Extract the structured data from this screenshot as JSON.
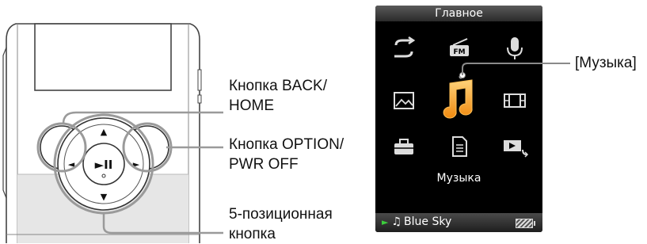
{
  "labels": {
    "back_home": [
      "Кнопка BACK/",
      "HOME"
    ],
    "option_pwr": [
      "Кнопка OPTION/",
      "PWR OFF"
    ],
    "five_way": [
      "5-позиционная",
      "кнопка"
    ],
    "music_callout": "[Музыка]"
  },
  "device": {
    "center_button": "►II",
    "arrows": {
      "up": "▲",
      "down": "▼",
      "left": "◄",
      "right": "►"
    }
  },
  "screen": {
    "title": "Главное",
    "caption": "Музыка",
    "icons": [
      "repeat-icon",
      "fm-radio-icon",
      "microphone-icon",
      "photo-icon",
      "music-note-icon",
      "video-film-icon",
      "settings-toolbox-icon",
      "document-icon",
      "now-playing-icon"
    ],
    "fm_badge": "FM",
    "status": {
      "play_symbol": "►",
      "note_symbol": "♫",
      "track": "Blue Sky"
    }
  },
  "colors": {
    "accent": "#f39a1e",
    "background": "#000000",
    "play": "#3ccf3c"
  }
}
